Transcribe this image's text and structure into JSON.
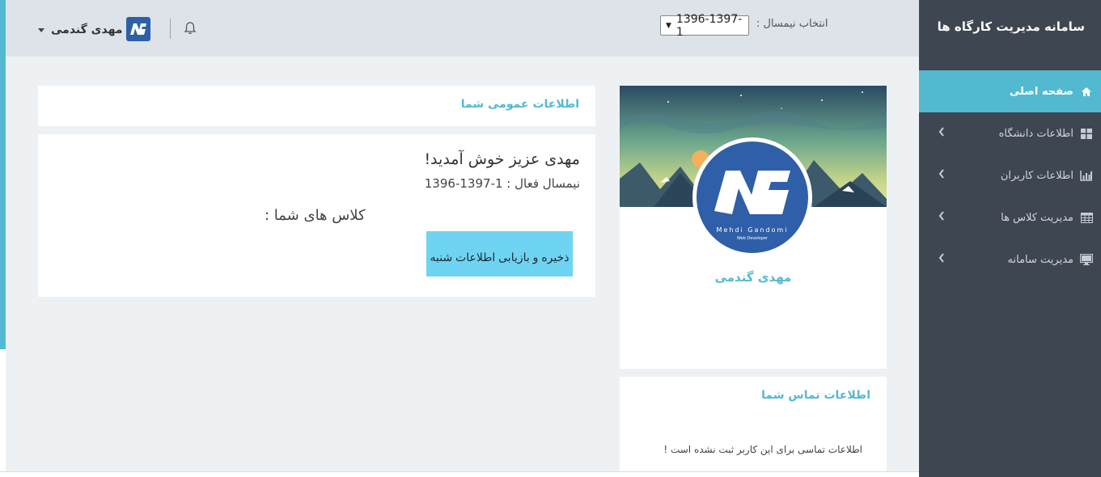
{
  "app": {
    "brand_title": "سامانه مدیریت کارگاه ها"
  },
  "header": {
    "username": "مهدی گندمی",
    "semester_label": "انتخاب نیمسال :",
    "semester_value": "1396-1397-1"
  },
  "sidebar": {
    "items": [
      {
        "label": "صفحه اصلی",
        "icon": "home-icon",
        "active": true
      },
      {
        "label": "اطلاعات دانشگاه",
        "icon": "grid-icon",
        "active": false
      },
      {
        "label": "اطلاعات کاربران",
        "icon": "bar-chart-icon",
        "active": false
      },
      {
        "label": "مدیریت کلاس ها",
        "icon": "table-icon",
        "active": false
      },
      {
        "label": "مدیریت سامانه",
        "icon": "monitor-icon",
        "active": false
      }
    ]
  },
  "general_info": {
    "title": "اطلاعات عمومی شما"
  },
  "welcome": {
    "heading": "مهدی عزیز خوش آمدید!",
    "active_semester_line": "نیمسال فعال : 1-1397-1396",
    "classes_label": "کلاس های شما :",
    "save_button_label": "ذخیره و بازیابی اطلاعات شنبه"
  },
  "profile": {
    "name": "مهدی گندمی",
    "logo_caption": "Mehdi Gandomi",
    "logo_subcaption": "Web Developer"
  },
  "contact": {
    "title": "اطلاعات تماس شما",
    "empty_message": "اطلاعات تماسی برای این کاربر ثبت نشده است !"
  },
  "colors": {
    "accent": "#53b9d1",
    "sidebar_bg": "#3e4651",
    "header_bg": "#dde3e9",
    "button_bg": "#6fd3f2",
    "logo_blue": "#2f5fa8"
  }
}
